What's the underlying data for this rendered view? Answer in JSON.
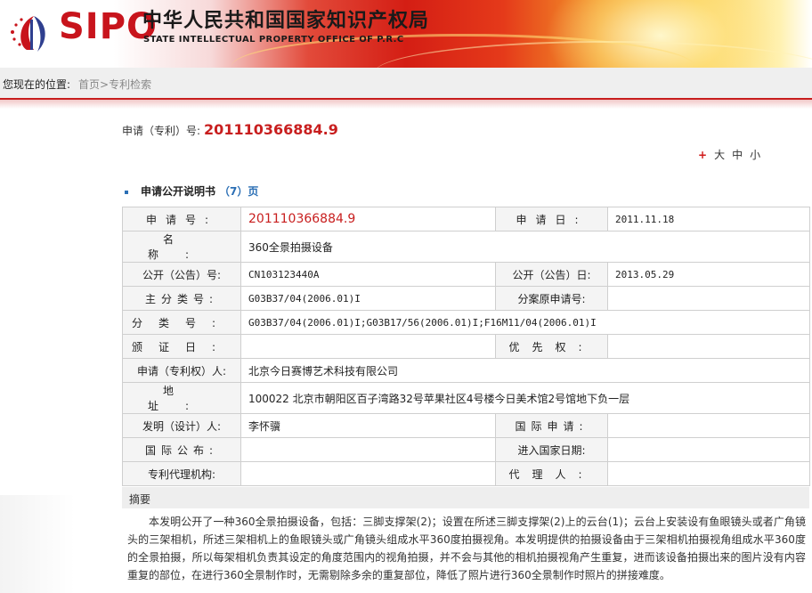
{
  "header": {
    "logo_text": "SIPO",
    "title_cn": "中华人民共和国国家知识产权局",
    "title_en": "STATE INTELLECTUAL PROPERTY OFFICE OF P.R.C"
  },
  "location": {
    "label": "您现在的位置:",
    "home": "首页",
    "sep": ">",
    "current": "专利检索"
  },
  "application": {
    "label": "申请（专利）号:",
    "number": "201110366884.9"
  },
  "font_size": {
    "plus": "+",
    "large": "大",
    "medium": "中",
    "small": "小"
  },
  "section": {
    "title": "申请公开说明书",
    "pages_prefix": "（",
    "pages_count": "7",
    "pages_suffix": "）页"
  },
  "table": {
    "row1": {
      "l1": "申请号:",
      "v1": "201110366884.9",
      "l2": "申请日:",
      "v2": "2011.11.18"
    },
    "row2": {
      "l1": "名称:",
      "v1": "360全景拍摄设备"
    },
    "row3": {
      "l1": "公开（公告）号:",
      "v1": "CN103123440A",
      "l2": "公开（公告）日:",
      "v2": "2013.05.29"
    },
    "row4": {
      "l1": "主分类号:",
      "v1": "G03B37/04(2006.01)I",
      "l2": "分案原申请号:",
      "v2": ""
    },
    "row5": {
      "l1": "分类号:",
      "v1": "G03B37/04(2006.01)I;G03B17/56(2006.01)I;F16M11/04(2006.01)I"
    },
    "row6": {
      "l1": "颁证日:",
      "v1": "",
      "l2": "优先权:",
      "v2": ""
    },
    "row7": {
      "l1": "申请（专利权）人:",
      "v1": "北京今日赛博艺术科技有限公司"
    },
    "row8": {
      "l1": "地址:",
      "v1": "100022 北京市朝阳区百子湾路32号苹果社区4号楼今日美术馆2号馆地下负一层"
    },
    "row9": {
      "l1": "发明（设计）人:",
      "v1": "李怀骥",
      "l2": "国际申请:",
      "v2": ""
    },
    "row10": {
      "l1": "国际公布:",
      "v1": "",
      "l2": "进入国家日期:",
      "v2": ""
    },
    "row11": {
      "l1": "专利代理机构:",
      "v1": "",
      "l2": "代理人:",
      "v2": ""
    }
  },
  "abstract": {
    "heading": "摘要",
    "text": "本发明公开了一种360全景拍摄设备，包括：三脚支撑架(2)；设置在所述三脚支撑架(2)上的云台(1)；云台上安装设有鱼眼镜头或者广角镜头的三架相机，所述三架相机上的鱼眼镜头或广角镜头组成水平360度拍摄视角。本发明提供的拍摄设备由于三架相机拍摄视角组成水平360度的全景拍摄，所以每架相机负责其设定的角度范围内的视角拍摄，并不会与其他的相机拍摄视角产生重复，进而该设备拍摄出来的图片没有内容重复的部位，在进行360全景制作时，无需剔除多余的重复部位，降低了照片进行360全景制作时照片的拼接难度。"
  }
}
